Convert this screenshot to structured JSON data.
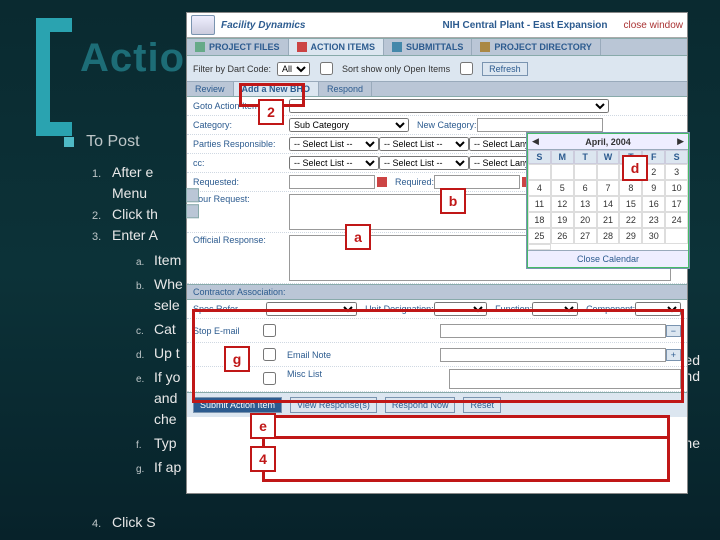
{
  "slide": {
    "title": "Action",
    "lead": "To Post",
    "steps": {
      "s1": "After e",
      "s1b": "Menu",
      "s2": "Click th",
      "s3": "Enter A",
      "a": "Item",
      "b": "Whe",
      "b2": "sele",
      "c": "Cat",
      "d": "Up t",
      "e": "If yo",
      "e2": "and",
      "e3": "che",
      "f": "Typ",
      "g": "If ap",
      "s4": "Click S"
    },
    "rtexts": {
      "t_e": "e",
      "t_ecked": "ecked",
      "t_And": "And",
      "t_ext": "ext, the"
    }
  },
  "markers": {
    "a": "a",
    "b": "b",
    "d": "d",
    "e": "e",
    "g": "g",
    "two": "2",
    "four": "4"
  },
  "app": {
    "brand": "Facility Dynamics",
    "projectTitle": "NIH Central Plant - East Expansion",
    "closeLabel": "close window",
    "tabs": {
      "project": "PROJECT FILES",
      "action": "ACTION ITEMS",
      "submittals": "SUBMITTALS",
      "directory": "PROJECT DIRECTORY"
    },
    "filter": {
      "label": "Filter by Dart Code:",
      "all": "All",
      "openLabel": "Sort show only Open Items",
      "refresh": "Refresh"
    },
    "subtabs": {
      "review": "Review",
      "add": "Add a New BHO",
      "respond": "Respond"
    },
    "labels": {
      "gotoAI": "Goto Action Item:",
      "category": "Category:",
      "newCategory": "New Category:",
      "partiesResp": "Parties Responsible:",
      "cc": "cc:",
      "requested": "Requested:",
      "required": "Required:",
      "yourRequest": "Your Request:",
      "officialResponse": "Official Response:",
      "contractorAssoc": "Contractor Association:",
      "stopEmail": "Stop E-mail",
      "emailNote": "Email Note",
      "miscList": "Misc List",
      "specRef": "Spec Refer",
      "unitDesignation": "Unit Designation:",
      "function": "Function:",
      "component": "Component:"
    },
    "selects": {
      "subCategory": "Sub Category",
      "selectList": "-- Select List --",
      "selectLany": "-- Select Lany --"
    },
    "calendar": {
      "title": "April, 2004",
      "close": "Close Calendar",
      "dh": [
        "S",
        "M",
        "T",
        "W",
        "T",
        "F",
        "S"
      ],
      "days": [
        "",
        "",
        "",
        "",
        "1",
        "2",
        "3",
        "4",
        "5",
        "6",
        "7",
        "8",
        "9",
        "10",
        "11",
        "12",
        "13",
        "14",
        "15",
        "16",
        "17",
        "18",
        "19",
        "20",
        "21",
        "22",
        "23",
        "24",
        "25",
        "26",
        "27",
        "28",
        "29",
        "30",
        "",
        ""
      ]
    },
    "buttons": {
      "submit": "Submit Action Item",
      "view": "View Response(s)",
      "respond": "Respond Now",
      "reset": "Reset"
    }
  }
}
